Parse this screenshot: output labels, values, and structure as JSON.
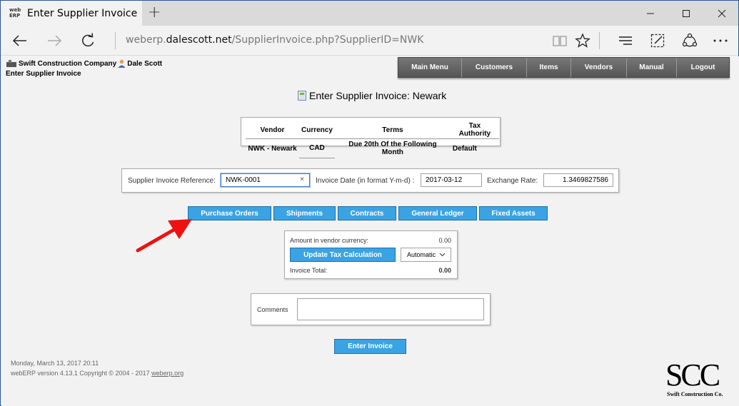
{
  "browser": {
    "tab_title": "Enter Supplier Invoice",
    "favicon_text": "web ERP",
    "url_prefix": "weberp.",
    "url_domain": "dalescott.net",
    "url_path": "/SupplierInvoice.php?SupplierID=NWK"
  },
  "header": {
    "company": "Swift Construction Company",
    "user": "Dale Scott",
    "page_subtitle": "Enter Supplier Invoice"
  },
  "menu": {
    "items": [
      "Main Menu",
      "Customers",
      "Items",
      "Vendors",
      "Manual",
      "Logout"
    ]
  },
  "main": {
    "heading": "Enter Supplier Invoice: Newark",
    "vendor_table": {
      "headers": [
        "Vendor",
        "Currency",
        "Terms",
        "Tax Authority"
      ],
      "row": [
        "NWK - Newark",
        "CAD",
        "Due 20th Of the Following Month",
        "Default"
      ]
    },
    "invoice_form": {
      "ref_label": "Supplier Invoice Reference:",
      "ref_value": "NWK-0001",
      "date_label": "Invoice Date (in format Y-m-d) :",
      "date_value": "2017-03-12",
      "rate_label": "Exchange Rate:",
      "rate_value": "1.3469827586"
    },
    "action_buttons": [
      "Purchase Orders",
      "Shipments",
      "Contracts",
      "General Ledger",
      "Fixed Assets"
    ],
    "amounts": {
      "vendor_currency_label": "Amount in vendor currency:",
      "vendor_currency_value": "0.00",
      "update_tax_label": "Update Tax Calculation",
      "tax_mode": "Automatic",
      "invoice_total_label": "Invoice Total:",
      "invoice_total_value": "0.00"
    },
    "comments_label": "Comments",
    "comments_value": "",
    "enter_button": "Enter Invoice"
  },
  "footer": {
    "datetime": "Monday, March 13, 2017 20:11",
    "version_text": "webERP version 4.13.1 Copyright © 2004 - 2017",
    "link_text": "weberp.org"
  },
  "logo": {
    "letters": "SCC",
    "subtitle": "Swift Construction Co."
  },
  "colors": {
    "accent_button": "#3aa3e3",
    "menu_bar": "#5b5b5b",
    "annotation_arrow": "#ee1111"
  }
}
